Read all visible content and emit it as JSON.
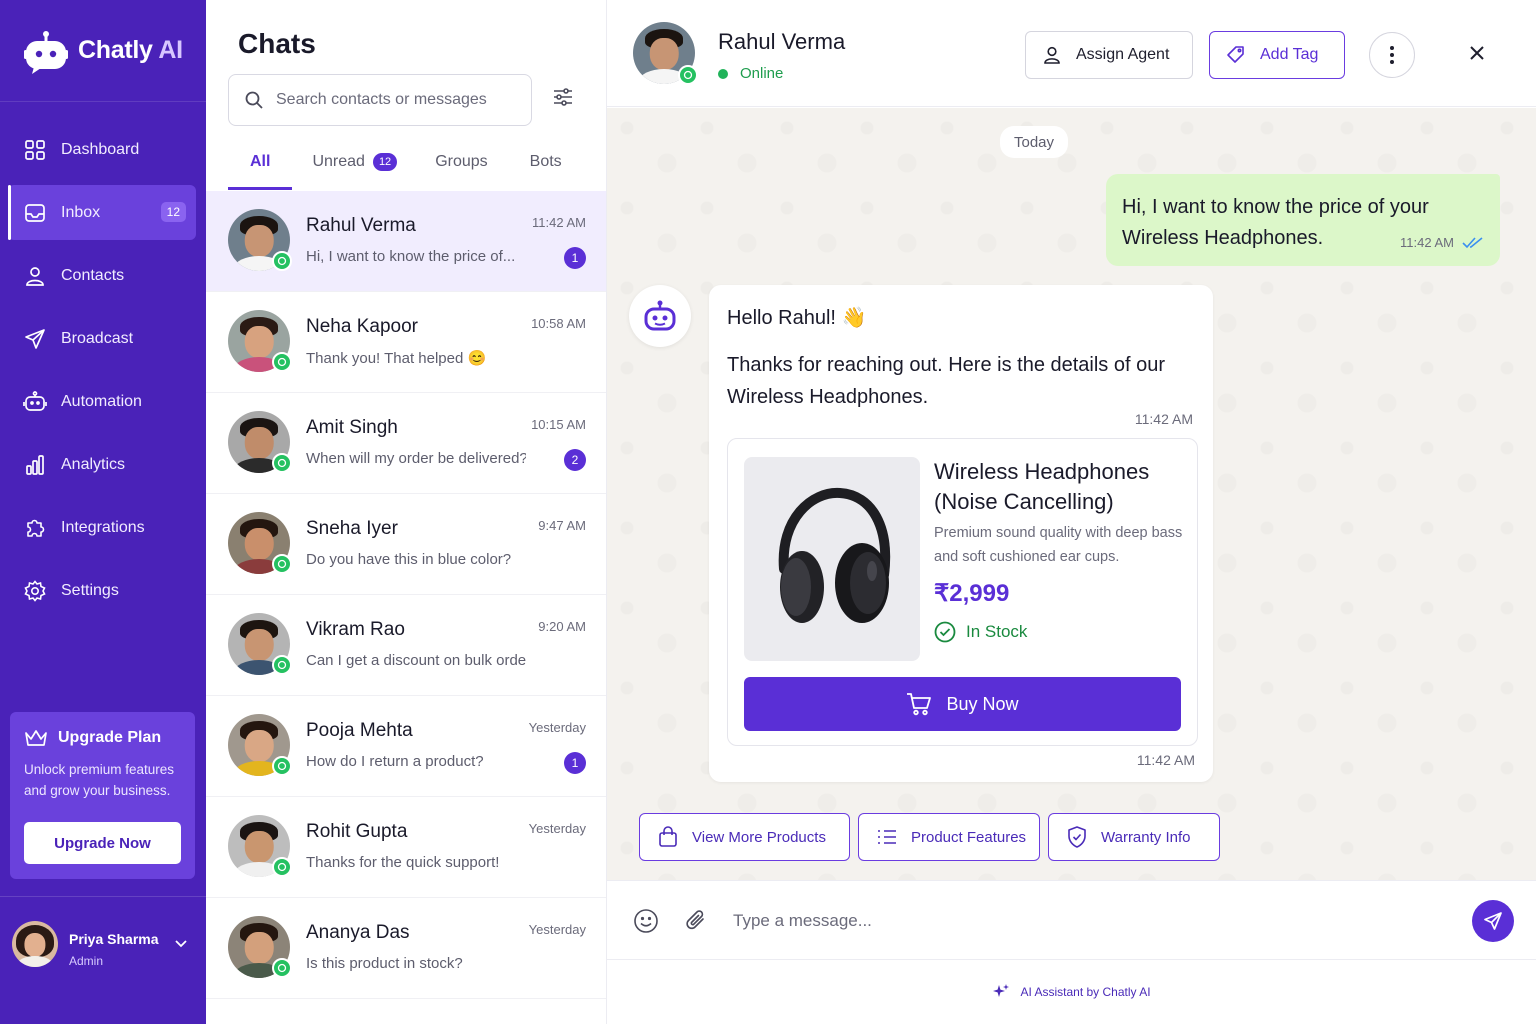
{
  "brand": {
    "name": "Chatly",
    "name_suffix": "AI"
  },
  "nav": [
    {
      "label": "Dashboard",
      "icon": "grid-icon"
    },
    {
      "label": "Inbox",
      "icon": "inbox-icon",
      "badge": "12",
      "active": true
    },
    {
      "label": "Contacts",
      "icon": "user-icon"
    },
    {
      "label": "Broadcast",
      "icon": "send-icon"
    },
    {
      "label": "Automation",
      "icon": "robot-icon"
    },
    {
      "label": "Analytics",
      "icon": "bar-chart-icon"
    },
    {
      "label": "Integrations",
      "icon": "puzzle-icon"
    },
    {
      "label": "Settings",
      "icon": "gear-icon"
    }
  ],
  "upgrade": {
    "title": "Upgrade Plan",
    "text": "Unlock premium features and grow your business.",
    "button": "Upgrade Now"
  },
  "user": {
    "name": "Priya Sharma",
    "role": "Admin"
  },
  "chatlist": {
    "title": "Chats",
    "search_placeholder": "Search contacts or messages",
    "tabs": [
      {
        "label": "All",
        "active": true
      },
      {
        "label": "Unread",
        "badge": "12"
      },
      {
        "label": "Groups"
      },
      {
        "label": "Bots"
      }
    ],
    "items": [
      {
        "name": "Rahul Verma",
        "message": "Hi, I want to know the price of...",
        "time": "11:42 AM",
        "unread": "1",
        "selected": true
      },
      {
        "name": "Neha Kapoor",
        "message": "Thank you! That helped 😊",
        "time": "10:58 AM",
        "unread": ""
      },
      {
        "name": "Amit Singh",
        "message": "When will my order be delivered?",
        "time": "10:15 AM",
        "unread": "2"
      },
      {
        "name": "Sneha Iyer",
        "message": "Do you have this in blue color?",
        "time": "9:47 AM",
        "unread": ""
      },
      {
        "name": "Vikram Rao",
        "message": "Can I get a discount on bulk order?",
        "time": "9:20 AM",
        "unread": ""
      },
      {
        "name": "Pooja Mehta",
        "message": "How do I return a product?",
        "time": "Yesterday",
        "unread": "1"
      },
      {
        "name": "Rohit Gupta",
        "message": "Thanks for the quick support!",
        "time": "Yesterday",
        "unread": ""
      },
      {
        "name": "Ananya Das",
        "message": "Is this product in stock?",
        "time": "Yesterday",
        "unread": ""
      }
    ]
  },
  "conversation": {
    "contact_name": "Rahul Verma",
    "status": "Online",
    "assign_label": "Assign Agent",
    "tag_label": "Add Tag",
    "date_divider": "Today",
    "outgoing": {
      "text": "Hi, I want to know the price of your Wireless Headphones.",
      "time": "11:42 AM"
    },
    "incoming": {
      "greeting": "Hello Rahul! 👋",
      "text": "Thanks for reaching out. Here is the details of our Wireless Headphones.",
      "time": "11:42 AM",
      "card_time": "11:42 AM"
    },
    "product": {
      "title": "Wireless Headphones (Noise Cancelling)",
      "description": "Premium sound quality with deep bass and soft cushioned ear cups.",
      "price": "₹2,999",
      "stock": "In Stock",
      "buy_label": "Buy Now"
    },
    "quick_replies": [
      "View More Products",
      "Product Features",
      "Warranty Info"
    ],
    "composer_placeholder": "Type a message...",
    "footer": "AI Assistant by Chatly AI"
  },
  "colors": {
    "brand": "#4a22b8",
    "accent": "#5a2fd6",
    "online": "#21b35a",
    "outgoing_bubble": "#dcf7c9"
  }
}
